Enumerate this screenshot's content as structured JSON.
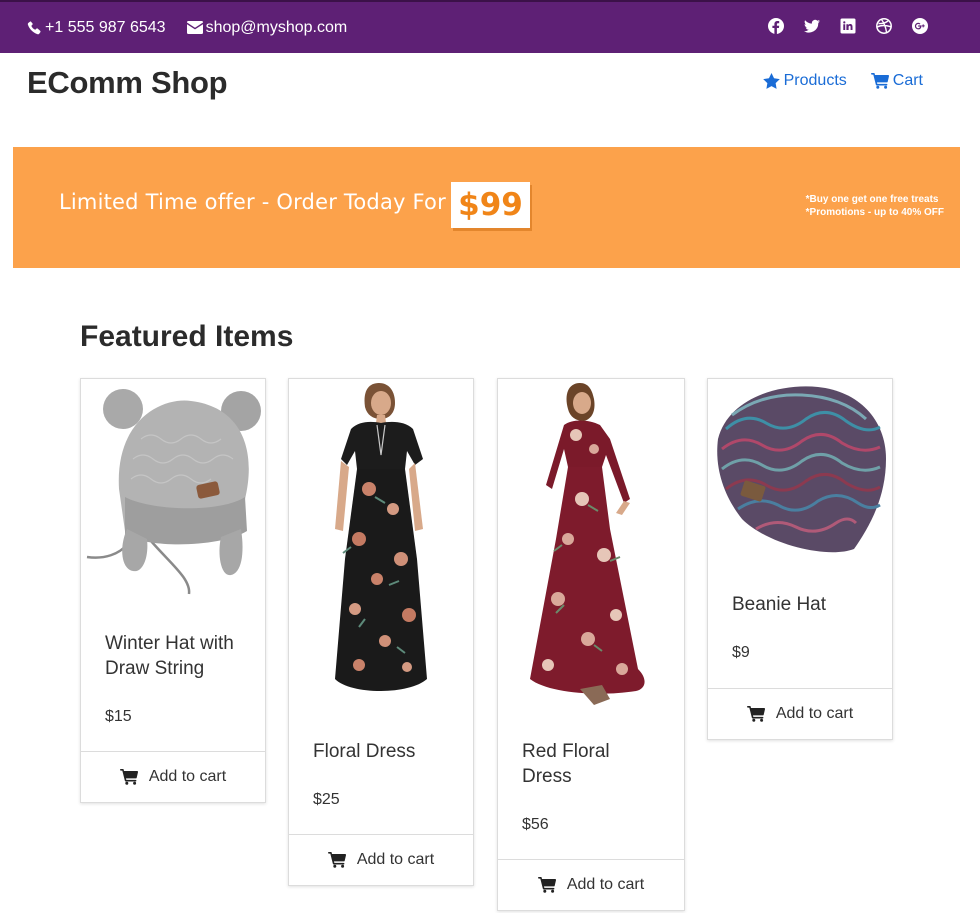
{
  "topbar": {
    "phone": "+1 555 987 6543",
    "email": "shop@myshop.com",
    "social": [
      "facebook-icon",
      "twitter-icon",
      "linkedin-icon",
      "dribbble-icon",
      "google-plus-icon"
    ]
  },
  "header": {
    "brand": "EComm Shop",
    "nav": {
      "products": "Products",
      "cart": "Cart"
    }
  },
  "banner": {
    "text": "Limited Time offer - Order Today For",
    "price": "$99",
    "note1": "*Buy one get one free treats",
    "note2": "*Promotions - up to 40% OFF"
  },
  "featured": {
    "title": "Featured Items",
    "products": [
      {
        "name": "Winter Hat with Draw String",
        "price": "$15",
        "button": "Add to cart"
      },
      {
        "name": "Floral Dress",
        "price": "$25",
        "button": "Add to cart"
      },
      {
        "name": "Red Floral Dress",
        "price": "$56",
        "button": "Add to cart"
      },
      {
        "name": "Beanie Hat",
        "price": "$9",
        "button": "Add to cart"
      }
    ]
  },
  "colors": {
    "topbar": "#5e2075",
    "link": "#1a6cd6",
    "banner": "#fca24b"
  }
}
